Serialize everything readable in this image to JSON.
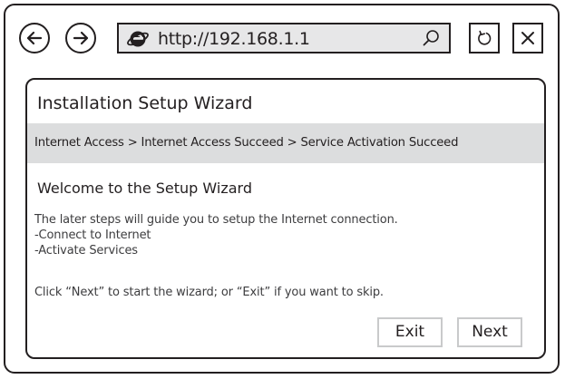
{
  "toolbar": {
    "back_icon": "arrow-left-icon",
    "forward_icon": "arrow-right-icon",
    "url": "http://192.168.1.1",
    "browser_icon": "internet-explorer-icon",
    "search_icon": "magnifier-icon",
    "refresh_icon": "refresh-icon",
    "close_icon": "close-icon"
  },
  "wizard": {
    "title": "Installation Setup Wizard",
    "breadcrumb": "Internet Access > Internet Access Succeed > Service Activation Succeed",
    "welcome": "Welcome to the Setup Wizard",
    "description_lines": [
      "The later steps will guide you to setup the Internet connection.",
      "-Connect to Internet",
      "-Activate Services"
    ],
    "hint": "Click “Next” to start the wizard; or “Exit” if you want to skip.",
    "exit_label": "Exit",
    "next_label": "Next"
  },
  "colors": {
    "ink": "#231f20",
    "address_bar": "#e7e7e8",
    "breadcrumb_bar": "#dcddde",
    "button_border": "#c9cacb"
  }
}
